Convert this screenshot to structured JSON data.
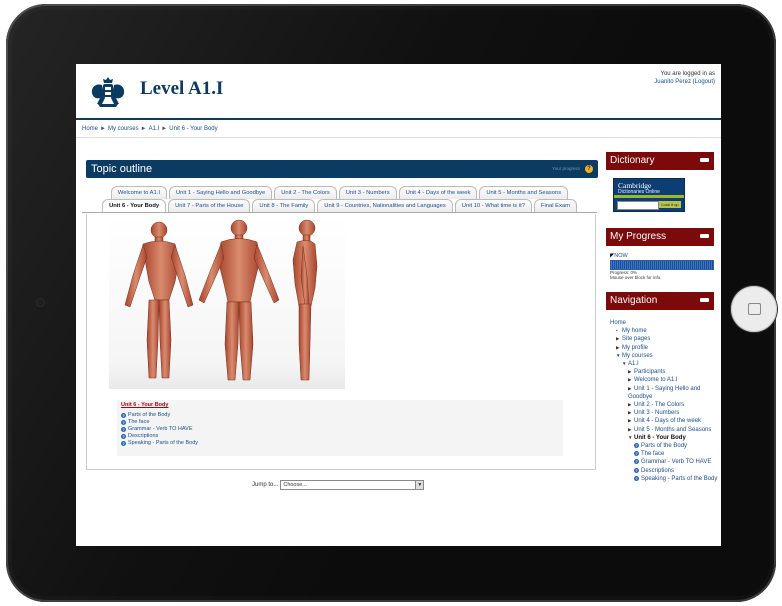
{
  "header": {
    "site_title": "Level A1.I",
    "login_line1": "You are logged in as",
    "login_user": "Juanito Perez",
    "logout": "(Logout)"
  },
  "breadcrumb": [
    "Home",
    "My courses",
    "A1.I",
    "Unit 6 - Your Body"
  ],
  "breadcrumb_sep": "►",
  "main": {
    "topic_title": "Topic outline",
    "your_progress": "Your progress",
    "tabs_row1": [
      "Welcome to A1.I",
      "Unit 1 - Saying Hello and Goodbye",
      "Unit 2 - The Colors",
      "Unit 3 - Numbers",
      "Unit 4 - Days of the week",
      "Unit 5 - Months and Seasons"
    ],
    "tabs_row2": [
      "Unit 6 - Your Body",
      "Unit 7 - Parts of the House",
      "Unit 8 - The Family",
      "Unit 9 - Countries, Nationalities and Languages",
      "Unit 10 - What time is it?",
      "Final Exam"
    ],
    "active_tab": "Unit 6 - Your Body",
    "section_title": "Unit 6 - Your Body",
    "activities": [
      "Parts of the Body",
      "The face",
      "Grammar - Verb TO HAVE",
      "Descriptions",
      "Speaking - Parts of the Body"
    ],
    "jump_label": "Jump to...",
    "jump_value": "Choose..."
  },
  "sidebar": {
    "dictionary": {
      "title": "Dictionary",
      "brand_line1": "Cambridge",
      "brand_line2": "Dictionaries Online",
      "button": "Look it up"
    },
    "progress": {
      "title": "My Progress",
      "now": "NOW",
      "progress_text": "Progress: 0%",
      "hint": "Mouse over block for info.",
      "fraction": 0.0
    },
    "navigation": {
      "title": "Navigation",
      "items": [
        {
          "label": "Home",
          "level": 0,
          "marker": ""
        },
        {
          "label": "My home",
          "level": 1,
          "marker": "•"
        },
        {
          "label": "Site pages",
          "level": 1,
          "marker": "▶"
        },
        {
          "label": "My profile",
          "level": 1,
          "marker": "▶"
        },
        {
          "label": "My courses",
          "level": 1,
          "marker": "▼"
        },
        {
          "label": "A1.I",
          "level": 2,
          "marker": "▼"
        },
        {
          "label": "Participants",
          "level": 3,
          "marker": "▶"
        },
        {
          "label": "Welcome to A1.I",
          "level": 3,
          "marker": "▶"
        },
        {
          "label": "Unit 1 - Saying Hello and Goodbye",
          "level": 3,
          "marker": "▶"
        },
        {
          "label": "Unit 2 - The Colors",
          "level": 3,
          "marker": "▶"
        },
        {
          "label": "Unit 3 - Numbers",
          "level": 3,
          "marker": "▶"
        },
        {
          "label": "Unit 4 - Days of the week",
          "level": 3,
          "marker": "▶"
        },
        {
          "label": "Unit 5 - Months and Seasons",
          "level": 3,
          "marker": "▶"
        },
        {
          "label": "Unit 6 - Your Body",
          "level": 3,
          "marker": "▼"
        },
        {
          "label": "Parts of the Body",
          "level": 4,
          "marker": "?"
        },
        {
          "label": "The face",
          "level": 4,
          "marker": "?"
        },
        {
          "label": "Grammar - Verb TO HAVE",
          "level": 4,
          "marker": "?"
        },
        {
          "label": "Descriptions",
          "level": 4,
          "marker": "?"
        },
        {
          "label": "Speaking - Parts of the Body",
          "level": 4,
          "marker": "?"
        }
      ]
    }
  },
  "colors": {
    "brand_navy": "#0b3a63",
    "block_red": "#7c0a0a",
    "link_blue": "#1a4d8f"
  }
}
